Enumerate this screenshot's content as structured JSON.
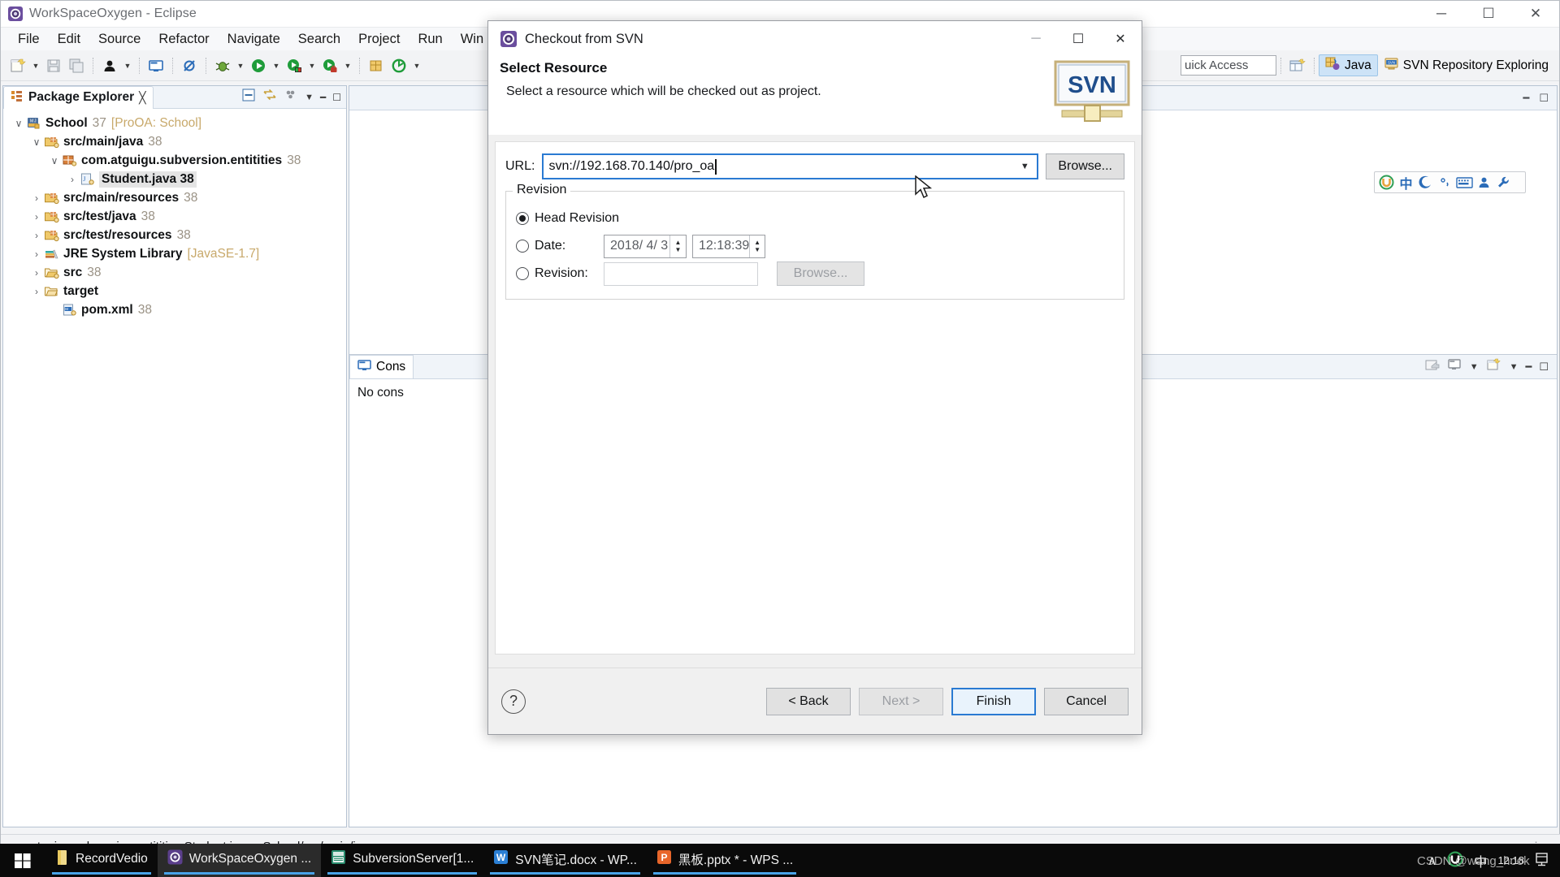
{
  "window": {
    "title": "WorkSpaceOxygen - Eclipse",
    "app_icon": "eclipse-icon",
    "minimize": "─",
    "maximize": "☐",
    "close": "✕"
  },
  "menu": {
    "items": [
      {
        "label": "File"
      },
      {
        "label": "Edit"
      },
      {
        "label": "Source"
      },
      {
        "label": "Refactor"
      },
      {
        "label": "Navigate"
      },
      {
        "label": "Search"
      },
      {
        "label": "Project"
      },
      {
        "label": "Run"
      },
      {
        "label": "Win"
      }
    ]
  },
  "toolbar": {
    "quick_access_placeholder": "uick Access",
    "perspectives": [
      {
        "label": "Java",
        "icon": "java-perspective-icon",
        "active": true
      },
      {
        "label": "SVN Repository Exploring",
        "icon": "svn-perspective-icon",
        "active": false
      }
    ],
    "open_perspective_icon": "open-perspective-icon"
  },
  "package_explorer": {
    "tab_label": "Package Explorer",
    "tab_close": "╳",
    "tools": [
      "collapse-all-icon",
      "link-with-editor-icon",
      "view-menu-icon",
      "minimize-icon",
      "maximize-icon"
    ],
    "tree": [
      {
        "indent": 0,
        "twisty": "∨",
        "icon": "maven-project-icon",
        "label": "School",
        "suffix": "37",
        "bracket": "[ProOA: School]",
        "selected": false
      },
      {
        "indent": 1,
        "twisty": "∨",
        "icon": "source-folder-icon",
        "label": "src/main/java",
        "suffix": "38",
        "bracket": "",
        "selected": false
      },
      {
        "indent": 2,
        "twisty": "∨",
        "icon": "package-icon",
        "label": "com.atguigu.subversion.entitities",
        "suffix": "38",
        "bracket": "",
        "selected": false
      },
      {
        "indent": 3,
        "twisty": "›",
        "icon": "java-file-icon",
        "label": "Student.java 38",
        "suffix": "",
        "bracket": "",
        "selected": true
      },
      {
        "indent": 1,
        "twisty": "›",
        "icon": "source-folder-icon",
        "label": "src/main/resources",
        "suffix": "38",
        "bracket": "",
        "selected": false
      },
      {
        "indent": 1,
        "twisty": "›",
        "icon": "source-folder-icon",
        "label": "src/test/java",
        "suffix": "38",
        "bracket": "",
        "selected": false
      },
      {
        "indent": 1,
        "twisty": "›",
        "icon": "source-folder-icon",
        "label": "src/test/resources",
        "suffix": "38",
        "bracket": "",
        "selected": false
      },
      {
        "indent": 1,
        "twisty": "›",
        "icon": "jre-library-icon",
        "label": "JRE System Library",
        "suffix": "",
        "bracket": "[JavaSE-1.7]",
        "selected": false
      },
      {
        "indent": 1,
        "twisty": "›",
        "icon": "folder-icon",
        "label": "src",
        "suffix": "38",
        "bracket": "",
        "selected": false
      },
      {
        "indent": 1,
        "twisty": "›",
        "icon": "folder-plain-icon",
        "label": "target",
        "suffix": "",
        "bracket": "",
        "selected": false
      },
      {
        "indent": 2,
        "twisty": "",
        "icon": "xml-file-icon",
        "label": "pom.xml",
        "suffix": "38",
        "bracket": "",
        "selected": false
      }
    ]
  },
  "console": {
    "tab_label": "Cons",
    "tab_icon": "console-icon",
    "body_text": "No cons",
    "tools": [
      "open-console-icon",
      "display-selected-console-icon",
      "console-dropdown-icon",
      "new-console-icon",
      "new-console-dropdown-icon",
      "minimize-icon",
      "maximize-icon"
    ]
  },
  "statusbar": {
    "text": "com.atguigu.subversion.entitities.Student.java - School/src/main/java",
    "grip": "⋮"
  },
  "ime_bar": {
    "icons": [
      "sogou-logo-icon",
      "chinese-mode-icon",
      "half-width-icon",
      "punctuation-icon",
      "soft-keyboard-icon",
      "user-icon",
      "tools-icon"
    ],
    "chinese_glyph": "中"
  },
  "dialog": {
    "window_title": "Checkout from SVN",
    "title_icon": "svn-checkout-icon",
    "minimize": "─",
    "maximize": "☐",
    "close": "✕",
    "heading": "Select Resource",
    "description": "Select a resource which will be checked out as project.",
    "banner_icon": "svn-banner-logo",
    "banner_text": "SVN",
    "url_label": "URL:",
    "url_value": "svn://192.168.70.140/pro_oa",
    "browse_label": "Browse...",
    "revision": {
      "legend": "Revision",
      "head_label": "Head Revision",
      "head_selected": true,
      "date_label": "Date:",
      "date_selected": false,
      "date_value": "2018/ 4/ 3",
      "time_value": "12:18:39",
      "revision_label": "Revision:",
      "revision_selected": false,
      "revision_value": "",
      "revision_browse_label": "Browse..."
    },
    "footer": {
      "help_icon": "help-icon",
      "back_label": "< Back",
      "next_label": "Next >",
      "next_disabled": true,
      "finish_label": "Finish",
      "finish_default": true,
      "cancel_label": "Cancel"
    }
  },
  "taskbar": {
    "start_icon": "windows-start-icon",
    "tasks": [
      {
        "label": "RecordVedio",
        "icon": "folder-task-icon",
        "active": false
      },
      {
        "label": "WorkSpaceOxygen ...",
        "icon": "eclipse-task-icon",
        "active": true
      },
      {
        "label": "SubversionServer[1...",
        "icon": "vmware-task-icon",
        "active": false
      },
      {
        "label": "SVN笔记.docx - WP...",
        "icon": "wps-writer-icon",
        "active": false
      },
      {
        "label": "黑板.pptx * - WPS ...",
        "icon": "wps-presentation-icon",
        "active": false
      }
    ],
    "tray": {
      "chevron": "∧",
      "ime_icon": "sogou-tray-icon",
      "ime_label": "中",
      "clock_time": "12:18",
      "show_desktop_icon": "show-desktop-icon"
    }
  },
  "watermark": "CSDN @wang_hook"
}
